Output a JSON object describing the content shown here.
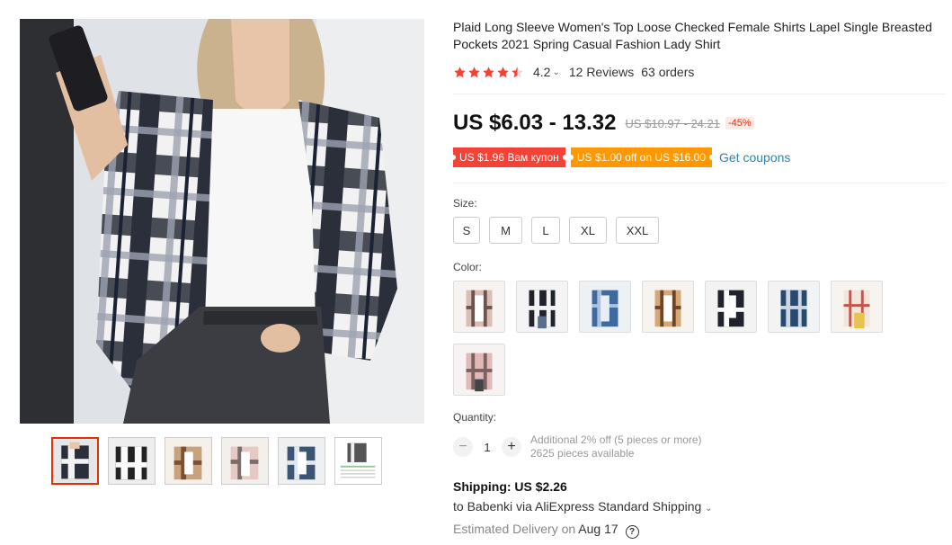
{
  "product": {
    "title": "Plaid Long Sleeve Women's Top Loose Checked Female Shirts Lapel Single Breasted Pockets 2021 Spring Casual Fashion Lady Shirt",
    "rating": "4.2",
    "rating_stars": 4.5,
    "reviews": "12 Reviews",
    "orders": "63 orders"
  },
  "price": {
    "current": "US $6.03 - 13.32",
    "original": "US $10.97 - 24.21",
    "discount": "-45%"
  },
  "coupons": {
    "coupon1": "US $1.96 Вам купон",
    "coupon2": "US $1.00 off on US $16.00",
    "get_link": "Get coupons"
  },
  "size": {
    "label": "Size:",
    "options": [
      "S",
      "M",
      "L",
      "XL",
      "XXL"
    ]
  },
  "color": {
    "label": "Color:",
    "swatch_count": 8
  },
  "quantity": {
    "label": "Quantity:",
    "minus": "−",
    "value": "1",
    "plus": "+",
    "note": "Additional 2% off (5 pieces or more)",
    "available": "2625 pieces available"
  },
  "shipping": {
    "title": "Shipping: US $2.26",
    "line": "to Babenki via AliExpress Standard Shipping",
    "delivery_prefix": "Estimated Delivery on",
    "delivery_date": "Aug 17"
  },
  "colors_hex": {
    "accent": "#e62e04",
    "link": "#2b84b8",
    "star": "#f44336",
    "coupon_red": "#f44336",
    "coupon_orange": "#ff9800"
  }
}
